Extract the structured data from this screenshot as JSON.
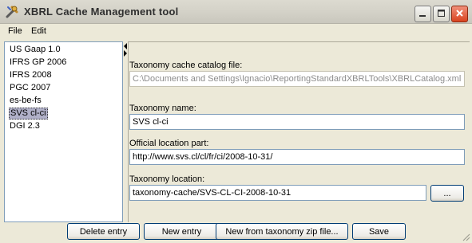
{
  "window": {
    "title": "XBRL Cache Management tool"
  },
  "menu": {
    "file": "File",
    "edit": "Edit"
  },
  "list": {
    "items": [
      {
        "label": "US Gaap 1.0",
        "selected": false
      },
      {
        "label": "IFRS GP 2006",
        "selected": false
      },
      {
        "label": "IFRS 2008",
        "selected": false
      },
      {
        "label": "PGC 2007",
        "selected": false
      },
      {
        "label": "es-be-fs",
        "selected": false
      },
      {
        "label": "SVS cl-ci",
        "selected": true
      },
      {
        "label": "DGI 2.3",
        "selected": false
      }
    ]
  },
  "form": {
    "catalog_label": "Taxonomy cache catalog file:",
    "catalog_value": "C:\\Documents and Settings\\Ignacio\\ReportingStandardXBRLTools\\XBRLCatalog.xml",
    "name_label": "Taxonomy name:",
    "name_value": "SVS cl-ci",
    "official_label": "Official location part:",
    "official_value": "http://www.svs.cl/cl/fr/ci/2008-10-31/",
    "location_label": "Taxonomy location:",
    "location_value": "taxonomy-cache/SVS-CL-CI-2008-10-31",
    "browse_label": "..."
  },
  "buttons": {
    "delete": "Delete entry",
    "new": "New entry",
    "new_zip": "New from taxonomy zip file...",
    "save": "Save"
  },
  "icons": {
    "app": "tools-icon",
    "minimize": "minimize-icon",
    "maximize": "maximize-icon",
    "close": "close-icon"
  }
}
